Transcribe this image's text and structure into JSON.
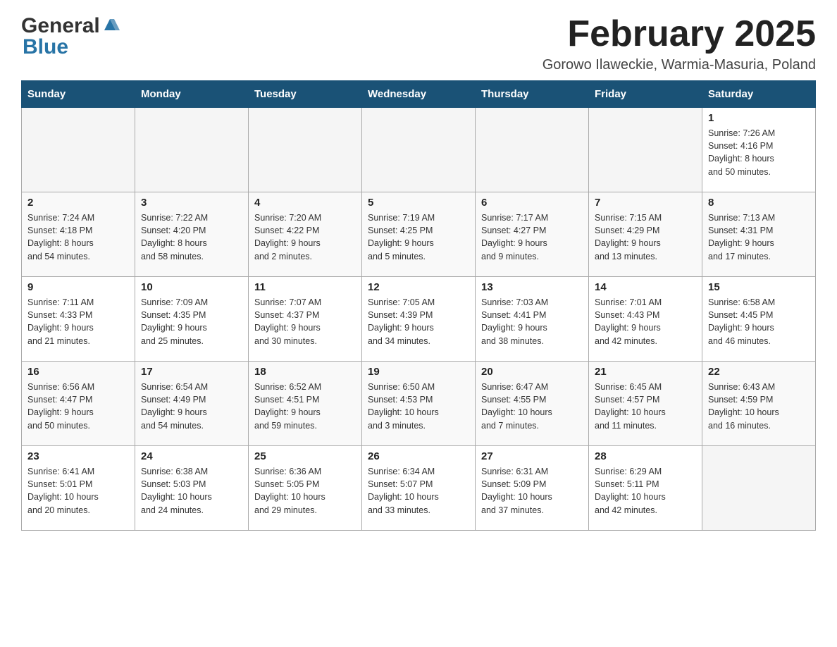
{
  "header": {
    "logo_general": "General",
    "logo_blue": "Blue",
    "month_title": "February 2025",
    "location": "Gorowo Ilaweckie, Warmia-Masuria, Poland"
  },
  "days_of_week": [
    "Sunday",
    "Monday",
    "Tuesday",
    "Wednesday",
    "Thursday",
    "Friday",
    "Saturday"
  ],
  "weeks": [
    [
      {
        "day": "",
        "info": ""
      },
      {
        "day": "",
        "info": ""
      },
      {
        "day": "",
        "info": ""
      },
      {
        "day": "",
        "info": ""
      },
      {
        "day": "",
        "info": ""
      },
      {
        "day": "",
        "info": ""
      },
      {
        "day": "1",
        "info": "Sunrise: 7:26 AM\nSunset: 4:16 PM\nDaylight: 8 hours\nand 50 minutes."
      }
    ],
    [
      {
        "day": "2",
        "info": "Sunrise: 7:24 AM\nSunset: 4:18 PM\nDaylight: 8 hours\nand 54 minutes."
      },
      {
        "day": "3",
        "info": "Sunrise: 7:22 AM\nSunset: 4:20 PM\nDaylight: 8 hours\nand 58 minutes."
      },
      {
        "day": "4",
        "info": "Sunrise: 7:20 AM\nSunset: 4:22 PM\nDaylight: 9 hours\nand 2 minutes."
      },
      {
        "day": "5",
        "info": "Sunrise: 7:19 AM\nSunset: 4:25 PM\nDaylight: 9 hours\nand 5 minutes."
      },
      {
        "day": "6",
        "info": "Sunrise: 7:17 AM\nSunset: 4:27 PM\nDaylight: 9 hours\nand 9 minutes."
      },
      {
        "day": "7",
        "info": "Sunrise: 7:15 AM\nSunset: 4:29 PM\nDaylight: 9 hours\nand 13 minutes."
      },
      {
        "day": "8",
        "info": "Sunrise: 7:13 AM\nSunset: 4:31 PM\nDaylight: 9 hours\nand 17 minutes."
      }
    ],
    [
      {
        "day": "9",
        "info": "Sunrise: 7:11 AM\nSunset: 4:33 PM\nDaylight: 9 hours\nand 21 minutes."
      },
      {
        "day": "10",
        "info": "Sunrise: 7:09 AM\nSunset: 4:35 PM\nDaylight: 9 hours\nand 25 minutes."
      },
      {
        "day": "11",
        "info": "Sunrise: 7:07 AM\nSunset: 4:37 PM\nDaylight: 9 hours\nand 30 minutes."
      },
      {
        "day": "12",
        "info": "Sunrise: 7:05 AM\nSunset: 4:39 PM\nDaylight: 9 hours\nand 34 minutes."
      },
      {
        "day": "13",
        "info": "Sunrise: 7:03 AM\nSunset: 4:41 PM\nDaylight: 9 hours\nand 38 minutes."
      },
      {
        "day": "14",
        "info": "Sunrise: 7:01 AM\nSunset: 4:43 PM\nDaylight: 9 hours\nand 42 minutes."
      },
      {
        "day": "15",
        "info": "Sunrise: 6:58 AM\nSunset: 4:45 PM\nDaylight: 9 hours\nand 46 minutes."
      }
    ],
    [
      {
        "day": "16",
        "info": "Sunrise: 6:56 AM\nSunset: 4:47 PM\nDaylight: 9 hours\nand 50 minutes."
      },
      {
        "day": "17",
        "info": "Sunrise: 6:54 AM\nSunset: 4:49 PM\nDaylight: 9 hours\nand 54 minutes."
      },
      {
        "day": "18",
        "info": "Sunrise: 6:52 AM\nSunset: 4:51 PM\nDaylight: 9 hours\nand 59 minutes."
      },
      {
        "day": "19",
        "info": "Sunrise: 6:50 AM\nSunset: 4:53 PM\nDaylight: 10 hours\nand 3 minutes."
      },
      {
        "day": "20",
        "info": "Sunrise: 6:47 AM\nSunset: 4:55 PM\nDaylight: 10 hours\nand 7 minutes."
      },
      {
        "day": "21",
        "info": "Sunrise: 6:45 AM\nSunset: 4:57 PM\nDaylight: 10 hours\nand 11 minutes."
      },
      {
        "day": "22",
        "info": "Sunrise: 6:43 AM\nSunset: 4:59 PM\nDaylight: 10 hours\nand 16 minutes."
      }
    ],
    [
      {
        "day": "23",
        "info": "Sunrise: 6:41 AM\nSunset: 5:01 PM\nDaylight: 10 hours\nand 20 minutes."
      },
      {
        "day": "24",
        "info": "Sunrise: 6:38 AM\nSunset: 5:03 PM\nDaylight: 10 hours\nand 24 minutes."
      },
      {
        "day": "25",
        "info": "Sunrise: 6:36 AM\nSunset: 5:05 PM\nDaylight: 10 hours\nand 29 minutes."
      },
      {
        "day": "26",
        "info": "Sunrise: 6:34 AM\nSunset: 5:07 PM\nDaylight: 10 hours\nand 33 minutes."
      },
      {
        "day": "27",
        "info": "Sunrise: 6:31 AM\nSunset: 5:09 PM\nDaylight: 10 hours\nand 37 minutes."
      },
      {
        "day": "28",
        "info": "Sunrise: 6:29 AM\nSunset: 5:11 PM\nDaylight: 10 hours\nand 42 minutes."
      },
      {
        "day": "",
        "info": ""
      }
    ]
  ]
}
